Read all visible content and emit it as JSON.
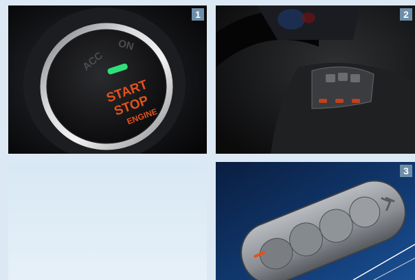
{
  "panels": [
    {
      "number": "1",
      "button": {
        "acc": "ACC",
        "on": "ON",
        "start": "START",
        "stop": "STOP",
        "engine": "ENGINE"
      }
    },
    {
      "number": "2"
    },
    {
      "number": "3"
    }
  ],
  "colors": {
    "badge": "#6d8ea8",
    "background": "#dce9f4",
    "button_text": "#e2521c",
    "indicator": "#2fe07a"
  }
}
